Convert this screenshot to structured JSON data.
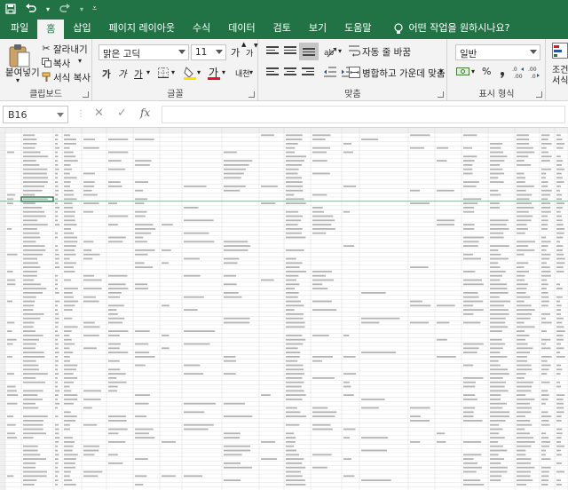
{
  "qat": {
    "save_icon": "save-icon",
    "undo_icon": "undo-icon",
    "redo_icon": "redo-icon",
    "customize_icon": "customize-qat-icon"
  },
  "tabs": [
    "파일",
    "홈",
    "삽입",
    "페이지 레이아웃",
    "수식",
    "데이터",
    "검토",
    "보기",
    "도움말"
  ],
  "tell_me": "어떤 작업을 원하시나요?",
  "clipboard": {
    "paste": "붙여넣기",
    "cut": "잘라내기",
    "copy": "복사",
    "format_painter": "서식 복사",
    "label": "클립보드"
  },
  "font": {
    "name": "맑은 고딕",
    "size": "11",
    "grow": "가",
    "shrink": "가",
    "bold": "가",
    "italic": "가",
    "underline": "가",
    "font_color_glyph": "가",
    "phonetic": "내천",
    "label": "글꼴"
  },
  "alignment": {
    "wrap_text": "자동 줄 바꿈",
    "merge_center": "병합하고 가운데 맞춤",
    "label": "맞춤"
  },
  "number": {
    "format": "일반",
    "label": "표시 형식",
    "percent": "%"
  },
  "styles": {
    "conditional_line1": "조건",
    "conditional_line2": "서식"
  },
  "formula_bar": {
    "name_box": "B16",
    "fx": "fx",
    "value": ""
  },
  "colors": {
    "accent": "#217346",
    "ribbon": "#f3f3f3",
    "font_red": "#e81123",
    "fill_yellow": "#ffe100"
  }
}
